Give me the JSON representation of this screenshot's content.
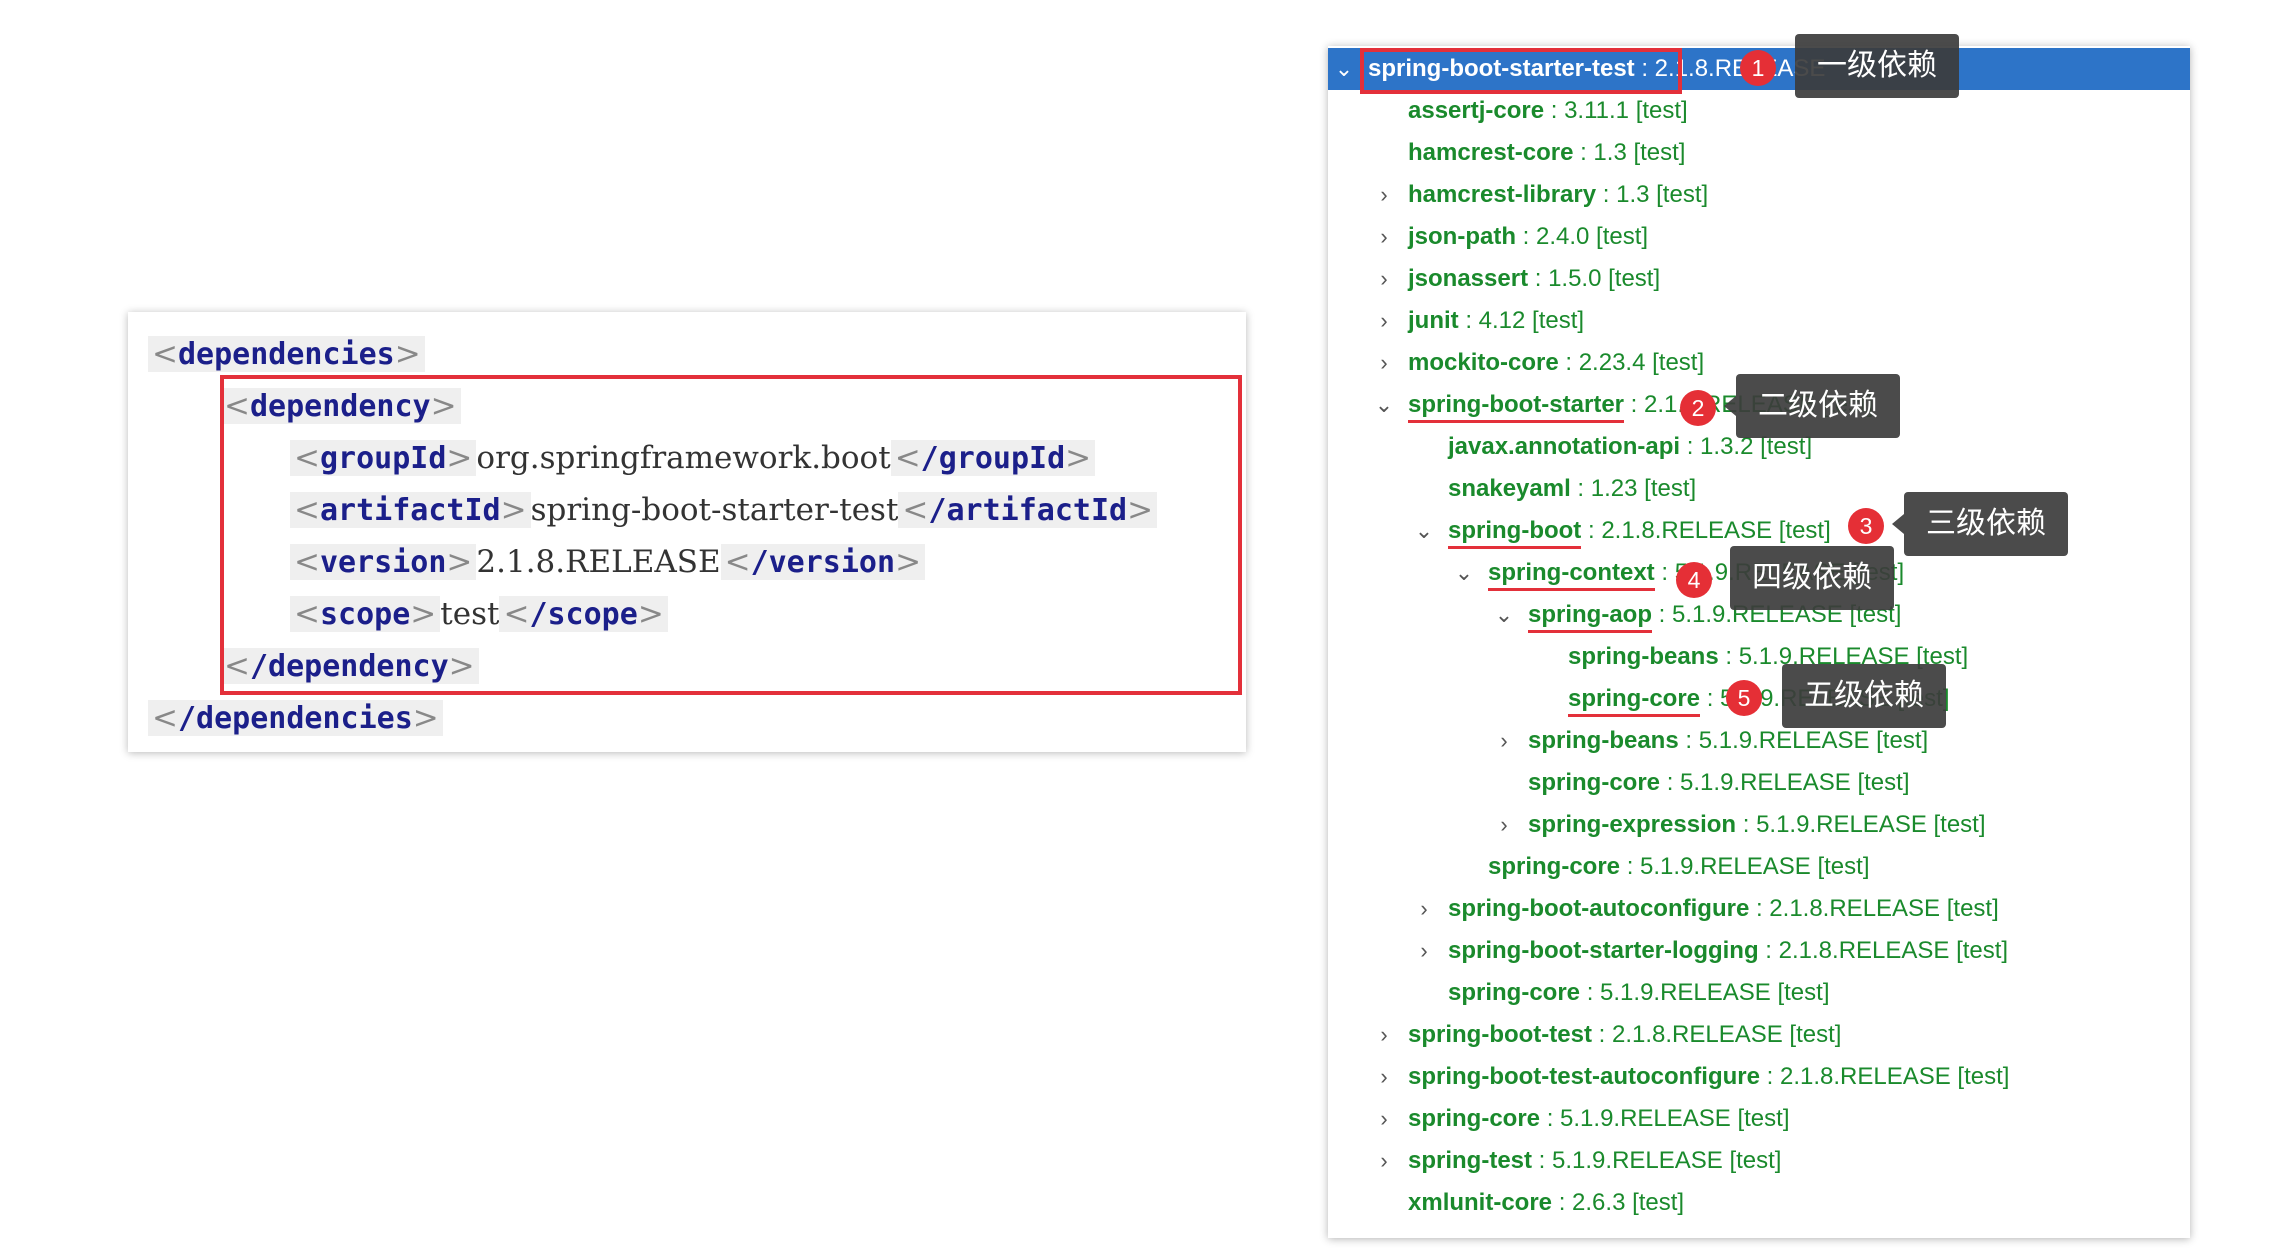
{
  "xml": {
    "open_dependencies": "dependencies",
    "open_dependency": "dependency",
    "group_tag": "groupId",
    "group_value": "org.springframework.boot",
    "artifact_tag": "artifactId",
    "artifact_value": "spring-boot-starter-test",
    "version_tag": "version",
    "version_value": "2.1.8.RELEASE",
    "scope_tag": "scope",
    "scope_value": "test",
    "close_dependency": "/dependency",
    "close_dependencies": "/dependencies"
  },
  "tree": {
    "rows": [
      {
        "name": "spring-boot-starter-test",
        "ver": " : 2.1.8.RELEASE",
        "scope": "",
        "arrow": "⌄"
      },
      {
        "name": "assertj-core",
        "ver": " : 3.11.1 [test]",
        "arrow": ""
      },
      {
        "name": "hamcrest-core",
        "ver": " : 1.3 [test]",
        "arrow": ""
      },
      {
        "name": "hamcrest-library",
        "ver": " : 1.3 [test]",
        "arrow": "›"
      },
      {
        "name": "json-path",
        "ver": " : 2.4.0 [test]",
        "arrow": "›"
      },
      {
        "name": "jsonassert",
        "ver": " : 1.5.0 [test]",
        "arrow": "›"
      },
      {
        "name": "junit",
        "ver": " : 4.12 [test]",
        "arrow": "›"
      },
      {
        "name": "mockito-core",
        "ver": " : 2.23.4 [test]",
        "arrow": "›"
      },
      {
        "name": "spring-boot-starter",
        "ver": " : 2.1.8.RELEASE [test]",
        "arrow": "⌄"
      },
      {
        "name": "javax.annotation-api",
        "ver": " : 1.3.2 [test]",
        "arrow": ""
      },
      {
        "name": "snakeyaml",
        "ver": " : 1.23 [test]",
        "arrow": ""
      },
      {
        "name": "spring-boot",
        "ver": " : 2.1.8.RELEASE [test]",
        "arrow": "⌄"
      },
      {
        "name": "spring-context",
        "ver": " : 5.1.9.RELEASE [test]",
        "arrow": "⌄"
      },
      {
        "name": "spring-aop",
        "ver": " : 5.1.9.RELEASE [test]",
        "arrow": "⌄"
      },
      {
        "name": "spring-beans",
        "ver": " : 5.1.9.RELEASE [test]",
        "arrow": ""
      },
      {
        "name": "spring-core",
        "ver": " : 5.1.9.RELEASE [test]",
        "arrow": ""
      },
      {
        "name": "spring-beans",
        "ver": " : 5.1.9.RELEASE [test]",
        "arrow": "›"
      },
      {
        "name": "spring-core",
        "ver": " : 5.1.9.RELEASE [test]",
        "arrow": ""
      },
      {
        "name": "spring-expression",
        "ver": " : 5.1.9.RELEASE [test]",
        "arrow": "›"
      },
      {
        "name": "spring-core",
        "ver": " : 5.1.9.RELEASE [test]",
        "arrow": ""
      },
      {
        "name": "spring-boot-autoconfigure",
        "ver": " : 2.1.8.RELEASE [test]",
        "arrow": "›"
      },
      {
        "name": "spring-boot-starter-logging",
        "ver": " : 2.1.8.RELEASE [test]",
        "arrow": "›"
      },
      {
        "name": "spring-core",
        "ver": " : 5.1.9.RELEASE [test]",
        "arrow": ""
      },
      {
        "name": "spring-boot-test",
        "ver": " : 2.1.8.RELEASE [test]",
        "arrow": "›"
      },
      {
        "name": "spring-boot-test-autoconfigure",
        "ver": " : 2.1.8.RELEASE [test]",
        "arrow": "›"
      },
      {
        "name": "spring-core",
        "ver": " : 5.1.9.RELEASE [test]",
        "arrow": "›"
      },
      {
        "name": "spring-test",
        "ver": " : 5.1.9.RELEASE [test]",
        "arrow": "›"
      },
      {
        "name": "xmlunit-core",
        "ver": " : 2.6.3 [test]",
        "arrow": ""
      }
    ]
  },
  "annotations": {
    "badge_1": "1",
    "label_1": "一级依赖",
    "badge_2": "2",
    "label_2": "二级依赖",
    "badge_3": "3",
    "label_3": "三级依赖",
    "badge_4": "4",
    "label_4": "四级依赖",
    "badge_5": "5",
    "label_5": "五级依赖"
  },
  "colors": {
    "artifact_green": "#1a8a2c",
    "xml_tag_navy": "#1b1f8a",
    "highlight_red": "#e3303a",
    "selection_blue": "#2d74c8",
    "callout_gray": "#3c3c3c"
  }
}
